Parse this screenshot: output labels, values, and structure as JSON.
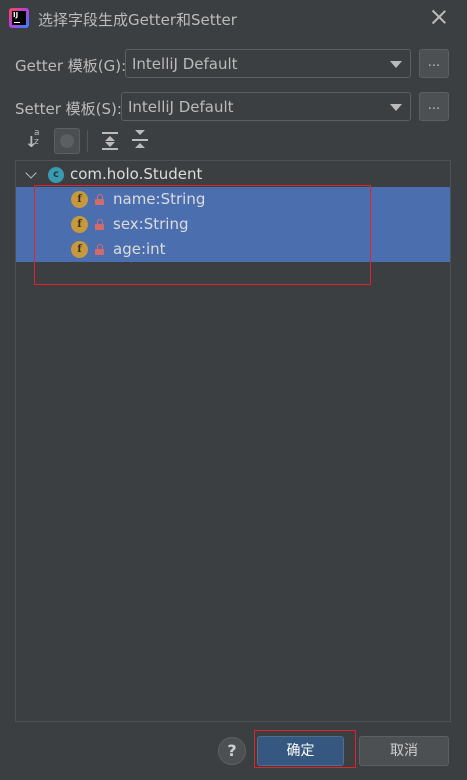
{
  "dialog": {
    "title": "选择字段生成Getter和Setter",
    "app_icon": "intellij-icon",
    "close_icon": "close-icon"
  },
  "getter": {
    "label": "Getter 模板(G):",
    "value": "IntelliJ Default",
    "more_label": "..."
  },
  "setter": {
    "label": "Setter 模板(S):",
    "value": "IntelliJ Default",
    "more_label": "..."
  },
  "toolbar": {
    "icons": [
      "sort-alphabetically-icon",
      "show-fields-icon",
      "expand-all-icon",
      "collapse-all-icon"
    ]
  },
  "tree": {
    "root": {
      "label": "com.holo.Student",
      "icon": "class-icon",
      "icon_letter": "c",
      "expanded": true
    },
    "fields": [
      {
        "label": "name:String",
        "icon_letter": "f",
        "access": "private",
        "selected": true
      },
      {
        "label": "sex:String",
        "icon_letter": "f",
        "access": "private",
        "selected": true
      },
      {
        "label": "age:int",
        "icon_letter": "f",
        "access": "private",
        "selected": true
      }
    ]
  },
  "footer": {
    "help_label": "?",
    "ok_label": "确定",
    "cancel_label": "取消"
  },
  "colors": {
    "background": "#3c3f41",
    "selection": "#4b6eaf",
    "primary_button": "#365880",
    "annotation_red": "#e0222c"
  }
}
